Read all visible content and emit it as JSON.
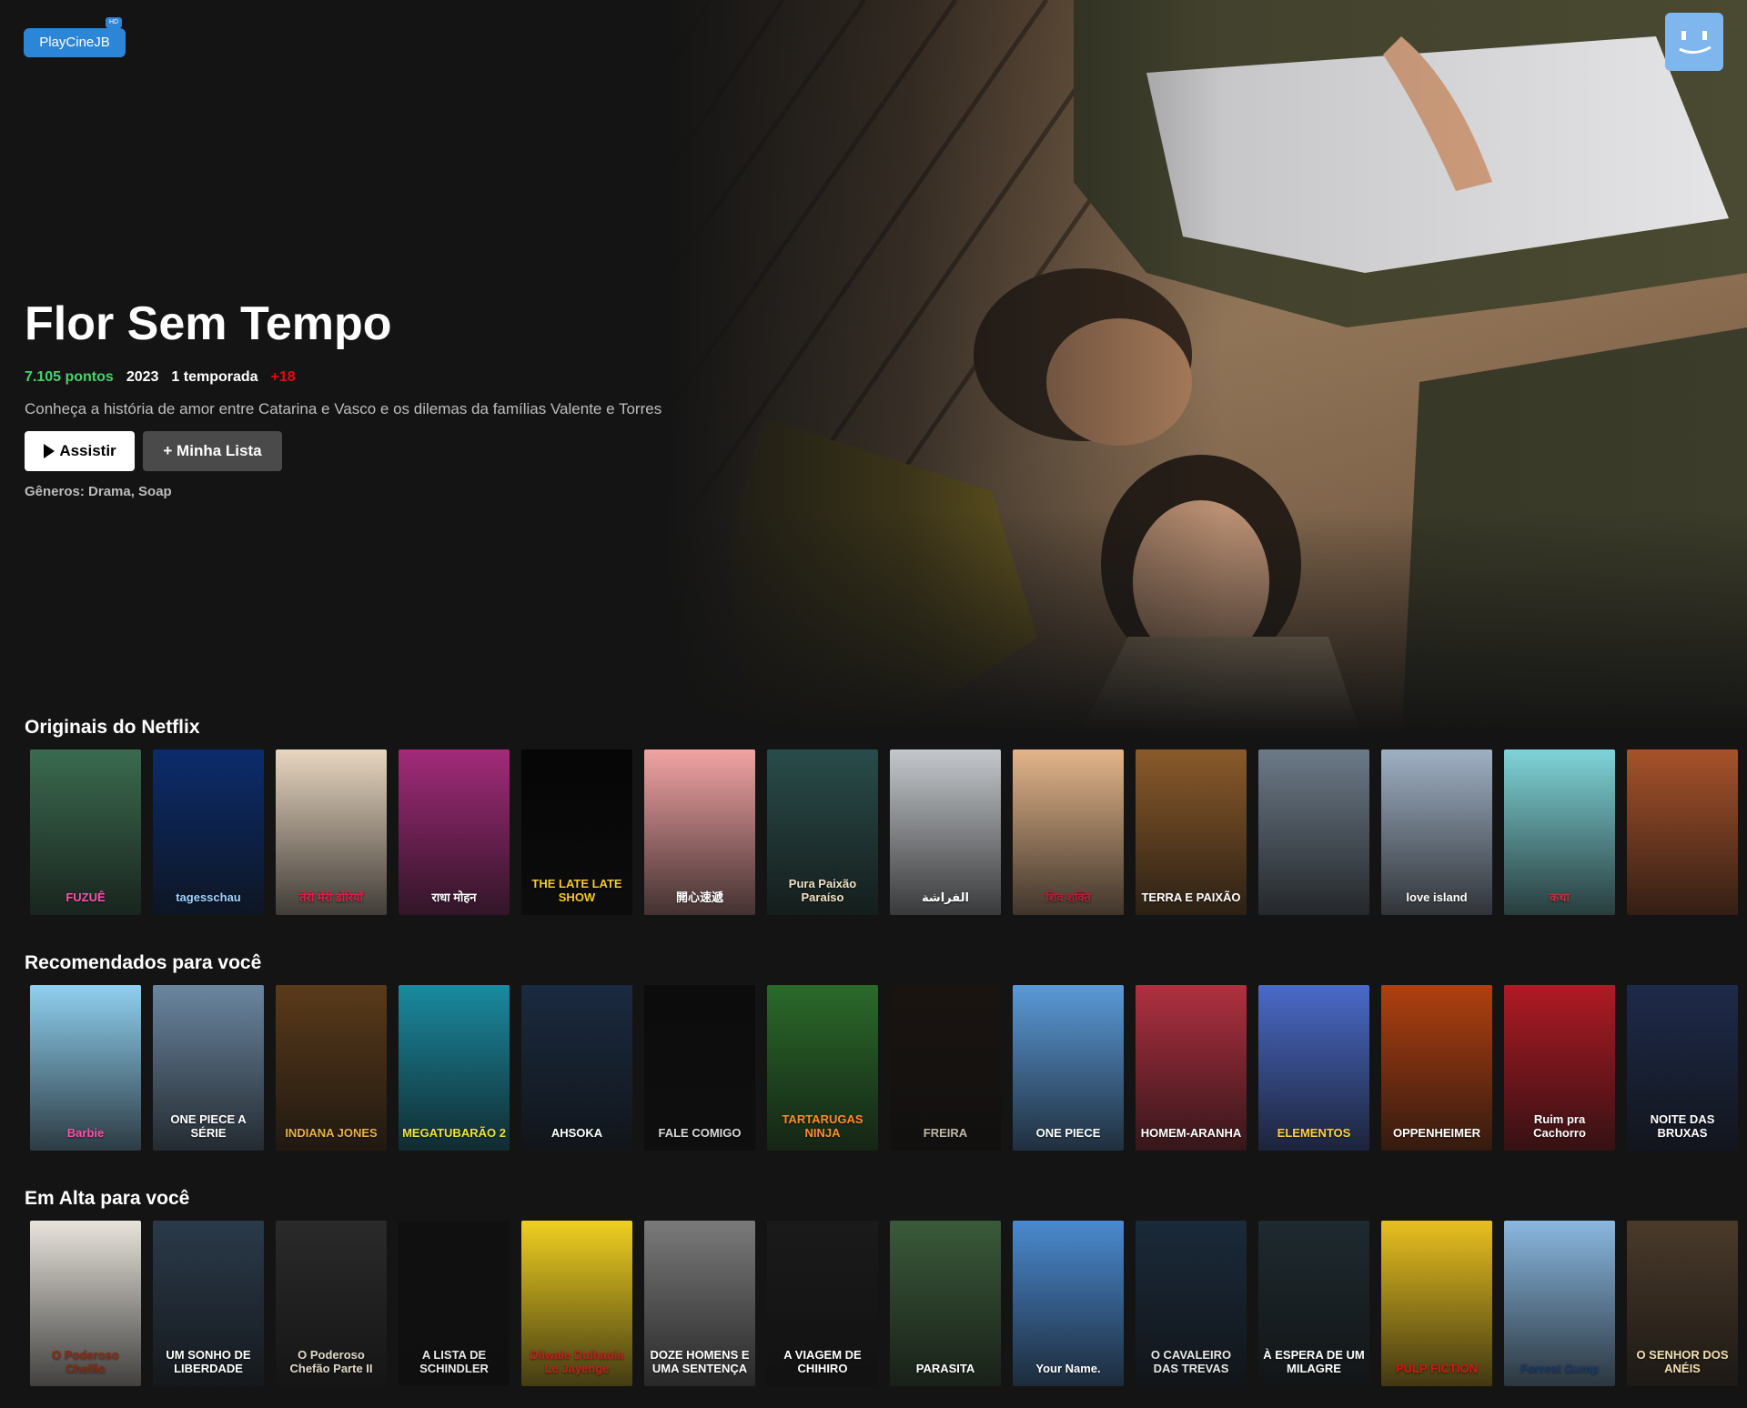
{
  "brand": {
    "logo_text": "PlayCineJB",
    "logo_badge": "HD"
  },
  "hero": {
    "title": "Flor Sem Tempo",
    "score": "7.105 pontos",
    "year": "2023",
    "seasons": "1 temporada",
    "age_rating": "+18",
    "description": "Conheça a história de amor entre Catarina e Vasco e os dilemas da famílias Valente e Torres",
    "play_label": "Assistir",
    "list_label": "+ Minha Lista",
    "genres": "Gêneros: Drama, Soap"
  },
  "rows": [
    {
      "title": "Originais do Netflix",
      "posters": [
        {
          "text": "FUZUÊ",
          "color": "#3a6b4f",
          "fg": "#ff4fb0"
        },
        {
          "text": "tagesschau",
          "color": "#0b2c6b",
          "fg": "#9fd0ff"
        },
        {
          "text": "तेरी मेरी डोरियाँ",
          "color": "#e8d6c0",
          "fg": "#d8204a"
        },
        {
          "text": "राधा मोहन",
          "color": "#a32a7a",
          "fg": "#ffffff"
        },
        {
          "text": "THE LATE LATE SHOW",
          "color": "#050505",
          "fg": "#f4c82b"
        },
        {
          "text": "開心速遞",
          "color": "#f2a3a3",
          "fg": "#ffffff"
        },
        {
          "text": "Pura Paixão Paraíso",
          "color": "#294c4a",
          "fg": "#f0e0c0"
        },
        {
          "text": "الفراشة",
          "color": "#c4c8cc",
          "fg": "#ffffff"
        },
        {
          "text": "शिव शक्ति",
          "color": "#e4b58a",
          "fg": "#b0203a"
        },
        {
          "text": "TERRA E PAIXÃO",
          "color": "#8a5a2a",
          "fg": "#ffffff"
        },
        {
          "text": "",
          "color": "#6c7a88",
          "fg": "#ffffff"
        },
        {
          "text": "love island",
          "color": "#9fb0c4",
          "fg": "#ffffff"
        },
        {
          "text": "कथा",
          "color": "#7fd4d8",
          "fg": "#c03040"
        },
        {
          "text": "",
          "color": "#a8522a",
          "fg": "#ffd24a"
        }
      ]
    },
    {
      "title": "Recomendados para você",
      "posters": [
        {
          "text": "Barbie",
          "color": "#8fd0f0",
          "fg": "#ff4fa8"
        },
        {
          "text": "ONE PIECE A SÉRIE",
          "color": "#6a86a0",
          "fg": "#ffffff"
        },
        {
          "text": "INDIANA JONES",
          "color": "#5a3a1a",
          "fg": "#e8b04a"
        },
        {
          "text": "MEGATUBARÃO 2",
          "color": "#1a8aa0",
          "fg": "#f0e040"
        },
        {
          "text": "AHSOKA",
          "color": "#1a2a40",
          "fg": "#ffffff"
        },
        {
          "text": "FALE COMIGO",
          "color": "#0c0c0c",
          "fg": "#d8d8d8"
        },
        {
          "text": "TARTARUGAS NINJA",
          "color": "#2a6a2a",
          "fg": "#ff8a2a"
        },
        {
          "text": "FREIRA",
          "color": "#1a1410",
          "fg": "#c0b8a8"
        },
        {
          "text": "ONE PIECE",
          "color": "#5a9ad8",
          "fg": "#ffffff"
        },
        {
          "text": "HOMEM-ARANHA",
          "color": "#b03040",
          "fg": "#ffffff"
        },
        {
          "text": "ELEMENTOS",
          "color": "#4a6ac8",
          "fg": "#ffd040"
        },
        {
          "text": "OPPENHEIMER",
          "color": "#b04010",
          "fg": "#ffffff"
        },
        {
          "text": "Ruim pra Cachorro",
          "color": "#b01a24",
          "fg": "#ffffff"
        },
        {
          "text": "NOITE DAS BRUXAS",
          "color": "#1e2a4a",
          "fg": "#ffffff"
        }
      ]
    },
    {
      "title": "Em Alta para você",
      "posters": [
        {
          "text": "O Poderoso Chefão",
          "color": "#e8e4dc",
          "fg": "#8a2a10"
        },
        {
          "text": "UM SONHO DE LIBERDADE",
          "color": "#2a3a4a",
          "fg": "#ffffff"
        },
        {
          "text": "O Poderoso Chefão Parte II",
          "color": "#2a2a2a",
          "fg": "#e0d8c8"
        },
        {
          "text": "A LISTA DE SCHINDLER",
          "color": "#101010",
          "fg": "#e8e8e8"
        },
        {
          "text": "Dilwale Dulhania Le Jayenge",
          "color": "#f0d020",
          "fg": "#c02020"
        },
        {
          "text": "DOZE HOMENS E UMA SENTENÇA",
          "color": "#7a7a7a",
          "fg": "#ffffff"
        },
        {
          "text": "A VIAGEM DE CHIHIRO",
          "color": "#1a1a1a",
          "fg": "#ffffff"
        },
        {
          "text": "PARASITA",
          "color": "#3a5a3a",
          "fg": "#ffffff"
        },
        {
          "text": "Your Name.",
          "color": "#4a8ad0",
          "fg": "#ffffff"
        },
        {
          "text": "O CAVALEIRO DAS TREVAS",
          "color": "#1a2a3a",
          "fg": "#e8e8e8"
        },
        {
          "text": "À ESPERA DE UM MILAGRE",
          "color": "#1e2a30",
          "fg": "#ffffff"
        },
        {
          "text": "PULP FICTION",
          "color": "#e8c020",
          "fg": "#d01818"
        },
        {
          "text": "Forrest Gump",
          "color": "#8ab8e0",
          "fg": "#1a3a6a"
        },
        {
          "text": "O SENHOR DOS ANÉIS",
          "color": "#4a3a2a",
          "fg": "#f0e0b0"
        }
      ]
    }
  ]
}
